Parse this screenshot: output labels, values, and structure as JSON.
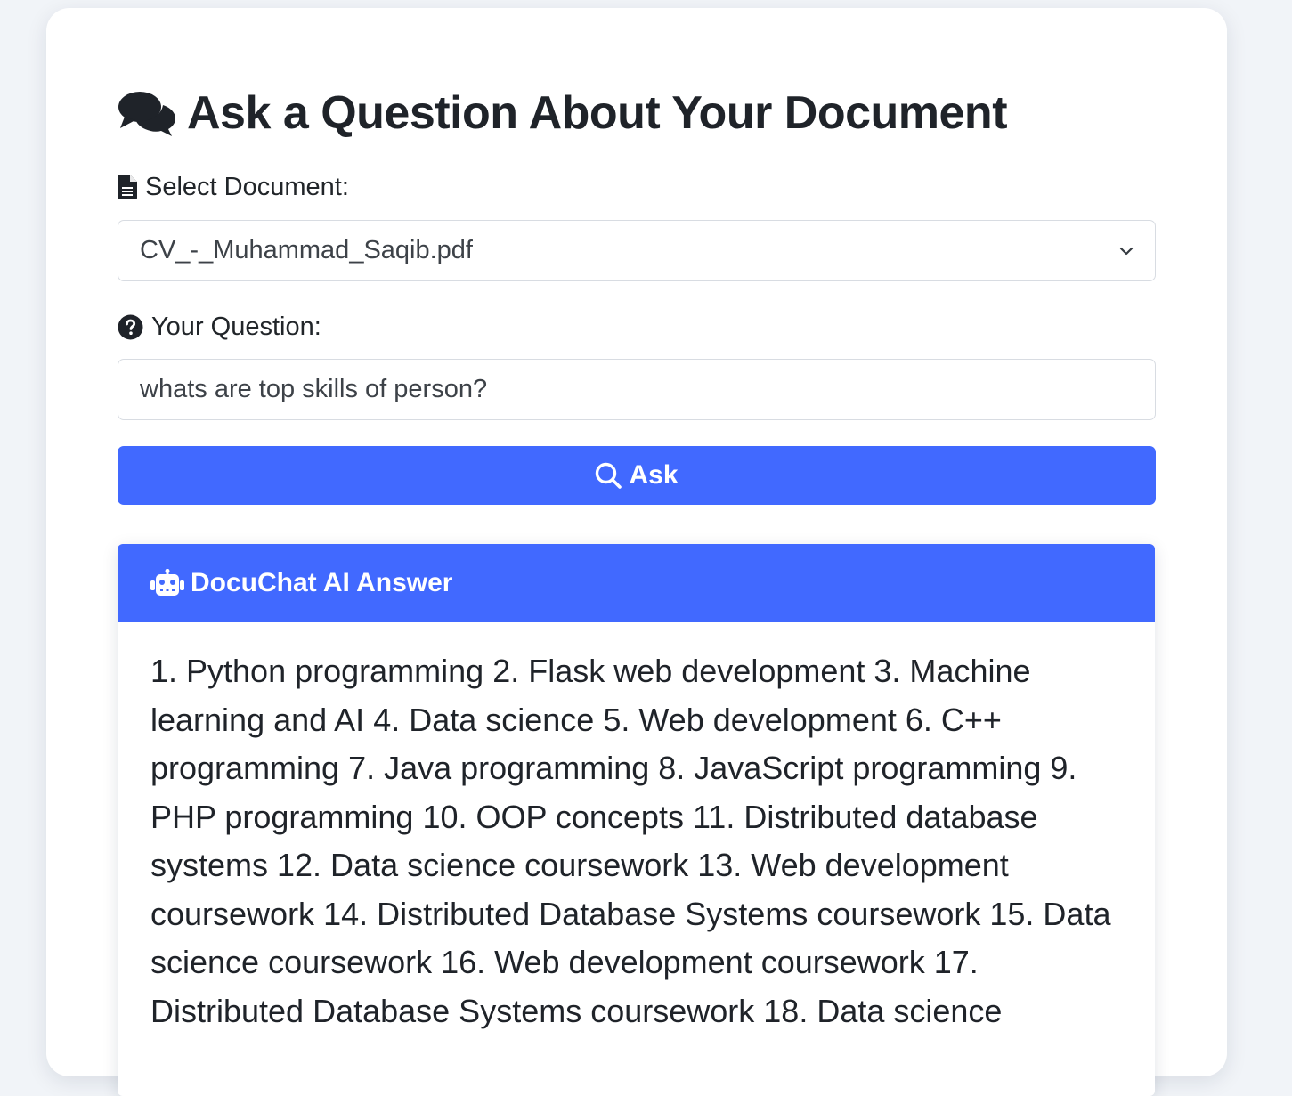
{
  "page": {
    "title": "Ask a Question About Your Document"
  },
  "form": {
    "document_label": "Select Document:",
    "selected_document": "CV_-_Muhammad_Saqib.pdf",
    "question_label": "Your Question:",
    "question_value": "whats are top skills of person?",
    "ask_button_label": "Ask"
  },
  "answer": {
    "header": "DocuChat AI Answer",
    "text": "1. Python programming 2. Flask web development 3. Machine learning and AI 4. Data science 5. Web development 6. C++ programming 7. Java programming 8. JavaScript programming 9. PHP programming 10. OOP concepts 11. Distributed database systems 12. Data science coursework 13. Web development coursework 14. Distributed Database Systems coursework 15. Data science coursework 16. Web development coursework 17. Distributed Database Systems coursework 18. Data science"
  },
  "colors": {
    "accent": "#4169ff",
    "background": "#f1f4f8",
    "card": "#ffffff",
    "text": "#212529"
  },
  "icons": {
    "title": "comments-icon",
    "document": "file-lines-icon",
    "question": "circle-question-icon",
    "ask": "magnifying-glass-icon",
    "answer": "robot-icon",
    "select": "chevron-down-icon"
  }
}
